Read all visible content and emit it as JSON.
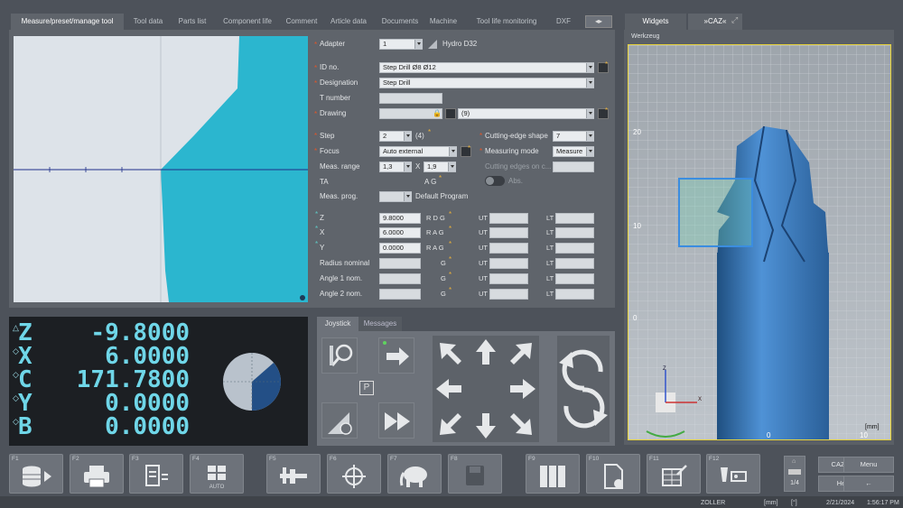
{
  "tabs": [
    "Measure/preset/manage tool",
    "Tool data",
    "Parts list",
    "Component life",
    "Comment",
    "Article data",
    "Documents",
    "Machine",
    "Tool life monitoring",
    "DXF"
  ],
  "right_tabs": [
    "Widgets",
    "»CAZ«"
  ],
  "form": {
    "adapter": {
      "label": "Adapter",
      "value": "1",
      "text": "Hydro D32"
    },
    "id_no": {
      "label": "ID no.",
      "value": "Step Drill Ø8 Ø12"
    },
    "designation": {
      "label": "Designation",
      "value": "Step Drill"
    },
    "t_number": {
      "label": "T number",
      "value": ""
    },
    "drawing": {
      "label": "Drawing",
      "value": "",
      "count": "(9)"
    },
    "step": {
      "label": "Step",
      "value": "2",
      "count": "(4)"
    },
    "focus": {
      "label": "Focus",
      "value": "Auto external"
    },
    "meas_range": {
      "label": "Meas. range",
      "value1": "1,3",
      "x": "X",
      "value2": "1,9"
    },
    "ta": {
      "label": "TA",
      "ag": "A G"
    },
    "meas_prog": {
      "label": "Meas. prog.",
      "text": "Default Program"
    },
    "cutting_edge_shape": {
      "label": "Cutting-edge shape",
      "value": "7"
    },
    "measuring_mode": {
      "label": "Measuring mode",
      "value": "Measure"
    },
    "cutting_edges_on": {
      "label": "Cutting edges on c...",
      "value": ""
    },
    "abs": {
      "label": "Abs."
    },
    "rows": [
      {
        "label": "Z",
        "value": "9.8000",
        "flags": "R D G",
        "ut": "UT",
        "lt": "LT"
      },
      {
        "label": "X",
        "value": "6.0000",
        "flags": "R A G",
        "ut": "UT",
        "lt": "LT"
      },
      {
        "label": "Y",
        "value": "0.0000",
        "flags": "R A G",
        "ut": "UT",
        "lt": "LT"
      },
      {
        "label": "Radius nominal",
        "value": "",
        "flags": "G",
        "ut": "UT",
        "lt": "LT"
      },
      {
        "label": "Angle 1 nom.",
        "value": "",
        "flags": "G",
        "ut": "UT",
        "lt": "LT"
      },
      {
        "label": "Angle 2 nom.",
        "value": "",
        "flags": "G",
        "ut": "UT",
        "lt": "LT"
      }
    ]
  },
  "dro": [
    {
      "axis": "Z",
      "value": "-9.8000"
    },
    {
      "axis": "X",
      "value": "6.0000"
    },
    {
      "axis": "C",
      "value": "171.7800"
    },
    {
      "axis": "Y",
      "value": "0.0000"
    },
    {
      "axis": "B",
      "value": "0.0000"
    }
  ],
  "joystick_tabs": [
    "Joystick",
    "Messages"
  ],
  "viewer": {
    "title": "Werkzeug",
    "y_ticks": [
      "20",
      "10",
      "0"
    ],
    "x_ticks": [
      "0",
      "10"
    ],
    "unit": "[mm]",
    "axis_z": "Z",
    "axis_x": "X"
  },
  "fkeys": [
    {
      "fn": "F1",
      "icon": "database-icon"
    },
    {
      "fn": "F2",
      "icon": "printer-icon"
    },
    {
      "fn": "F3",
      "icon": "list-icon"
    },
    {
      "fn": "F4",
      "icon": "auto-icon",
      "sub": "AUTO"
    },
    {
      "fn": "F5",
      "icon": "caliper-icon"
    },
    {
      "fn": "F6",
      "icon": "crosshair-icon"
    },
    {
      "fn": "F7",
      "icon": "elephant-icon"
    },
    {
      "fn": "F8",
      "icon": "save-icon"
    },
    {
      "fn": "F9",
      "icon": "binders-icon"
    },
    {
      "fn": "F10",
      "icon": "document-edit-icon"
    },
    {
      "fn": "F11",
      "icon": "table-edit-icon"
    },
    {
      "fn": "F12",
      "icon": "tool-measure-icon"
    }
  ],
  "page_indicator": "1/4",
  "side_buttons": {
    "cazwin": "CAZWin",
    "menu": "Menu",
    "help": "Help",
    "back": "←"
  },
  "status": {
    "brand": "ZOLLER",
    "unit": "[mm]",
    "angle": "[°]",
    "date": "2/21/2024",
    "time": "1:56:17 PM"
  },
  "colors": {
    "accent": "#3ab0cc",
    "tool_blue": "#3c7fc0",
    "dro_text": "#6fd6e8",
    "viewer_border": "#e6d23a"
  }
}
